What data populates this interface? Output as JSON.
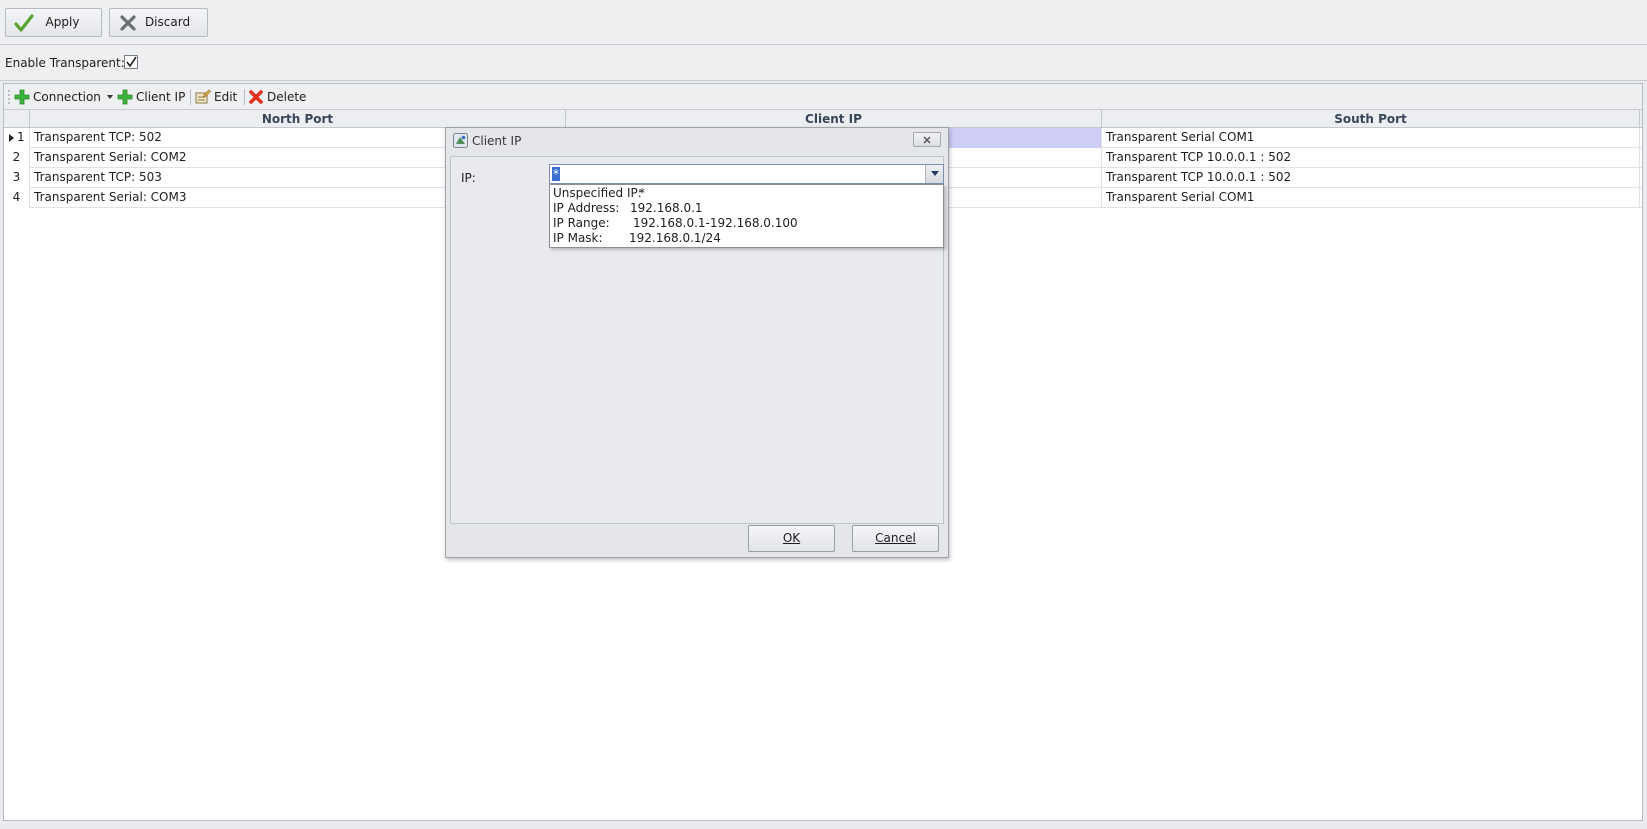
{
  "toolbar": {
    "apply_label": "Apply",
    "discard_label": "Discard"
  },
  "settings": {
    "enable_transparent_label": "Enable Transparent:",
    "enable_transparent_checked": true
  },
  "grid_toolbar": {
    "connection_label": "Connection",
    "client_ip_label": "Client IP",
    "edit_label": "Edit",
    "delete_label": "Delete"
  },
  "grid": {
    "columns": [
      "North Port",
      "Client IP",
      "South Port"
    ],
    "rows": [
      {
        "num": "1",
        "north": "Transparent TCP: 502",
        "client_ip": "",
        "south": "Transparent Serial COM1",
        "current": true
      },
      {
        "num": "2",
        "north": "Transparent Serial: COM2",
        "client_ip": "",
        "south": "Transparent TCP 10.0.0.1 : 502"
      },
      {
        "num": "3",
        "north": "Transparent TCP: 503",
        "client_ip": "",
        "south": "Transparent TCP 10.0.0.1 : 502"
      },
      {
        "num": "4",
        "north": "Transparent Serial: COM3",
        "client_ip": "",
        "south": "Transparent Serial COM1"
      }
    ]
  },
  "dialog": {
    "title": "Client IP",
    "ip_label": "IP:",
    "ip_value": "*",
    "options": [
      {
        "key": "Unspecified IP:",
        "value": "*"
      },
      {
        "key": "IP Address:",
        "value": "192.168.0.1"
      },
      {
        "key": "IP Range:",
        "value": "192.168.0.1-192.168.0.100"
      },
      {
        "key": "IP Mask:",
        "value": "192.168.0.1/24"
      }
    ],
    "ok_label": "OK",
    "cancel_label": "Cancel"
  },
  "colors": {
    "selected_cell": "#cdcdf6",
    "selection_highlight": "#3a6fcf",
    "add_icon": "#3cb43c",
    "delete_icon": "#e0301e"
  }
}
